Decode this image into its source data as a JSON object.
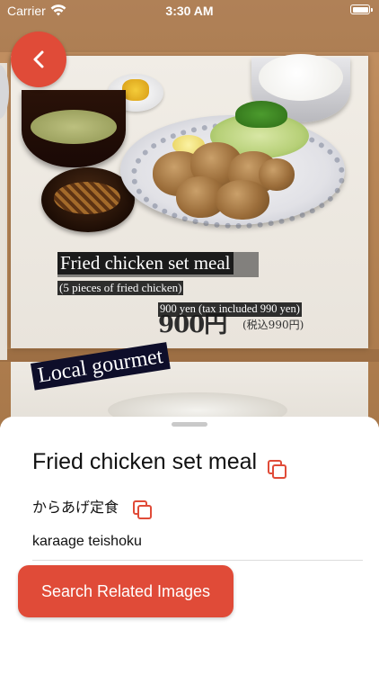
{
  "status_bar": {
    "carrier": "Carrier",
    "time": "3:30 AM",
    "icons": [
      "wifi-icon",
      "battery-icon"
    ]
  },
  "navigation": {
    "back_icon": "chevron-left-icon"
  },
  "photo": {
    "overlays": {
      "title": "Fried chicken set meal",
      "subtitle": "(5 pieces of fried chicken)",
      "price": "900 yen (tax included 990 yen)",
      "banner": "Local gourmet"
    },
    "original_print": {
      "price": "900円",
      "tax": "(税込990円)"
    }
  },
  "sheet": {
    "english": "Fried chicken set meal",
    "japanese": "からあげ定食",
    "romaji": "karaage teishoku",
    "search_button": "Search Related Images",
    "copy_icon": "copy-icon"
  },
  "colors": {
    "accent": "#e04b38",
    "overlay_bg": "#1b1b1b",
    "banner_bg": "#0e0e2a"
  }
}
